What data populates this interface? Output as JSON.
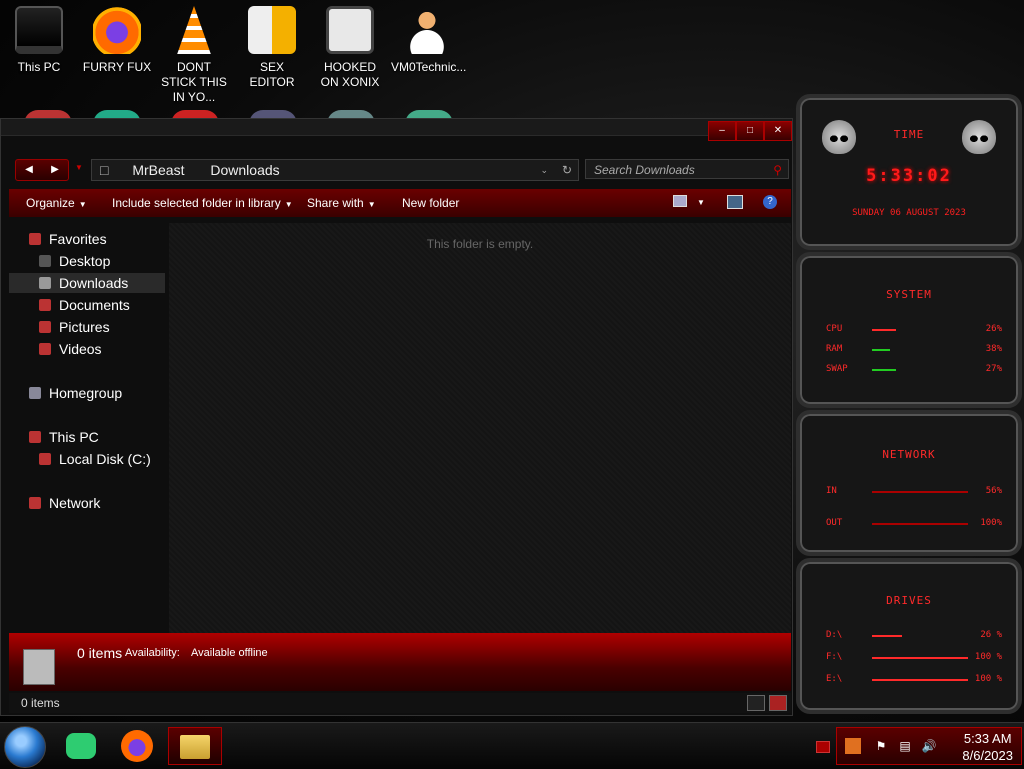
{
  "desktop": {
    "icons": [
      {
        "label": "This PC"
      },
      {
        "label": "FURRY FUX"
      },
      {
        "label": "DONT STICK THIS IN YO..."
      },
      {
        "label": "SEX EDITOR"
      },
      {
        "label": "HOOKED ON XONIX"
      },
      {
        "label": "VM0Technic..."
      }
    ]
  },
  "explorer": {
    "address": [
      "MrBeast",
      "Downloads"
    ],
    "search_placeholder": "Search Downloads",
    "commands": [
      "Organize",
      "Include selected folder in library",
      "Share with",
      "New folder"
    ],
    "nav": {
      "favorites": "Favorites",
      "desktop": "Desktop",
      "downloads": "Downloads",
      "documents": "Documents",
      "pictures": "Pictures",
      "videos": "Videos",
      "homegroup": "Homegroup",
      "this_pc": "This PC",
      "local_disk": "Local Disk (C:)",
      "network": "Network"
    },
    "empty_message": "This folder is empty.",
    "details": {
      "count": "0 items",
      "availability_label": "Availability:",
      "availability_value": "Available offline"
    },
    "status": "0 items"
  },
  "gadget": {
    "time_title": "TIME",
    "time": "5:33:02",
    "date": "SUNDAY 06 AUGUST 2023",
    "system_title": "SYSTEM",
    "system_rows": [
      {
        "label": "CPU",
        "value": "26%"
      },
      {
        "label": "RAM",
        "value": "38%"
      },
      {
        "label": "SWAP",
        "value": "27%"
      }
    ],
    "network_title": "NETWORK",
    "network_rows": [
      {
        "label": "IN",
        "value": "56%"
      },
      {
        "label": "OUT",
        "value": "100%"
      }
    ],
    "drives_title": "DRIVES",
    "drives_rows": [
      {
        "label": "D:\\",
        "value": "26 %"
      },
      {
        "label": "F:\\",
        "value": "100 %"
      },
      {
        "label": "E:\\",
        "value": "100 %"
      }
    ],
    "accent_color": "#ff1a1a"
  },
  "taskbar": {
    "time": "5:33 AM",
    "date": "8/6/2023"
  }
}
